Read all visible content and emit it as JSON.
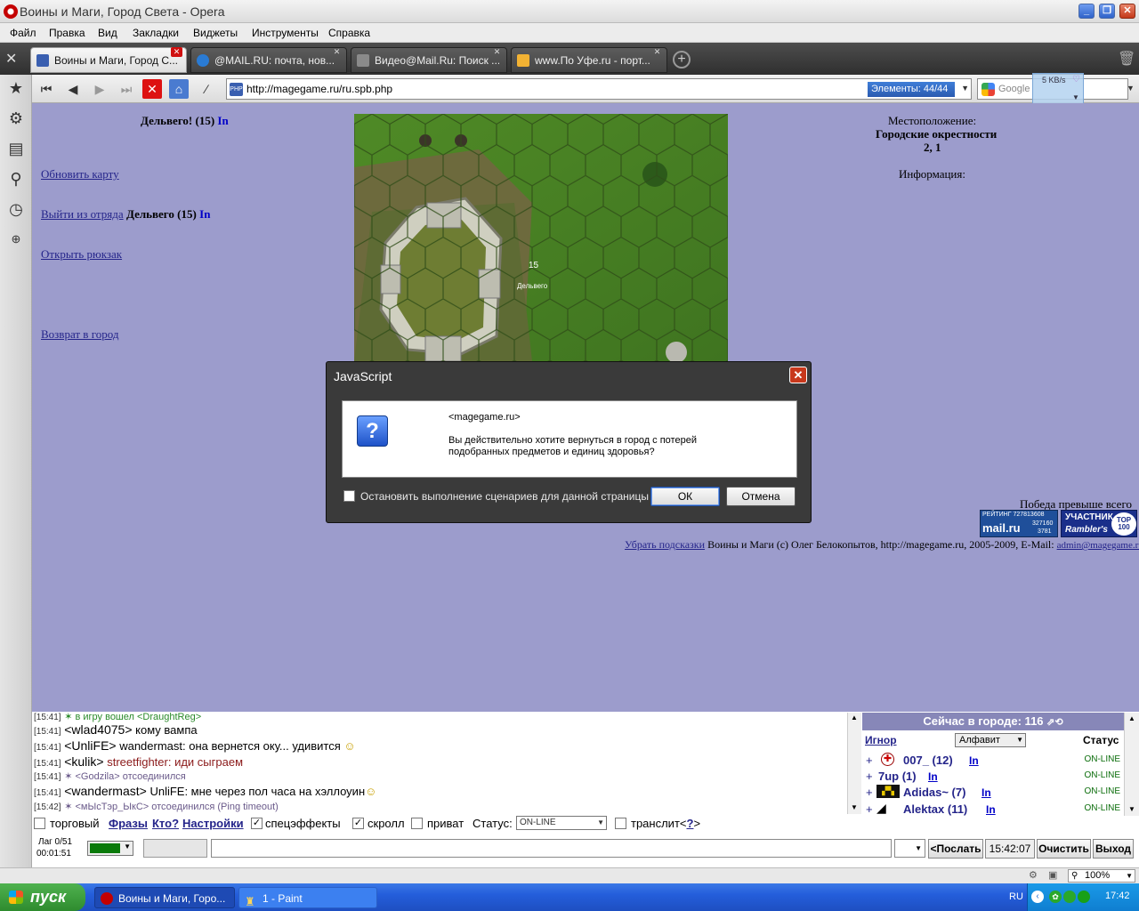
{
  "window": {
    "title": "Воины и Маги, Город Света - Opera"
  },
  "menu": [
    "Файл",
    "Правка",
    "Вид",
    "Закладки",
    "Виджеты",
    "Инструменты",
    "Справка"
  ],
  "tabs": [
    {
      "label": "Воины и Маги, Город С...",
      "active": true,
      "fav_color": "#3a5fb0"
    },
    {
      "label": "@MAIL.RU: почта, нов...",
      "active": false,
      "fav_color": "#2a7bd4"
    },
    {
      "label": "Видео@Mail.Ru: Поиск ...",
      "active": false,
      "fav_color": "#8a8a8a"
    },
    {
      "label": "www.По Уфе.ru - порт...",
      "active": false,
      "fav_color": "#f2b233"
    }
  ],
  "address": {
    "url": "http://magegame.ru/ru.spb.php",
    "progress": "Элементы:  44/44",
    "search_placeholder": "Google",
    "speed": "5 KB/s",
    "site_icon": "PHP"
  },
  "page": {
    "player_name": "Дельвего! (15)",
    "player_in": "In",
    "refresh_map": "Обновить карту",
    "leave_squad": "Выйти из отряда",
    "squad_member": "Дельвего (15)",
    "squad_in": "In",
    "open_backpack": "Открыть рюкзак",
    "return_city": "Возврат в город",
    "location_label": "Местоположение:",
    "location_name": "Городские окрестности",
    "location_coords": "2, 1",
    "info_label": "Информация:",
    "map_marker_level": "15",
    "map_marker_name": "Дельвего",
    "slogan": "Победа превыше всего",
    "hide_hints": "Убрать подсказки",
    "copyright": "Воины и Маги (c) Олег Белокопытов, http://magegame.ru, 2005-2009, E-Mail:",
    "email": "admin@magegame.ru",
    "counter_mail": "РЕЙТИНГ 727813608",
    "counter_mail_nums": [
      "327160",
      "3781"
    ],
    "counter_mail_brand": "mail.ru",
    "counter_rambler": "УЧАСТНИК",
    "counter_rambler_brand": "Rambler's",
    "counter_top": "TOP 100"
  },
  "dialog": {
    "title": "JavaScript",
    "host": "<magegame.ru>",
    "message": "Вы действительно хотите вернуться в город с потерей подобранных предметов и единиц здоровья?",
    "checkbox_label": "Остановить выполнение сценариев для данной страницы",
    "ok": "ОК",
    "cancel": "Отмена"
  },
  "chat": [
    {
      "time": "[15:41]",
      "kind": "sys",
      "text": "✶ в игру вошел <DraughtReg>"
    },
    {
      "time": "[15:41]",
      "kind": "msg",
      "nick": "<wlad4075>",
      "text": "кому вампа",
      "color": "#000000"
    },
    {
      "time": "[15:41]",
      "kind": "msg",
      "nick": "<UnliFE>",
      "text": "wandermast: она вернется оку... удивится",
      "color": "#000000"
    },
    {
      "time": "[15:41]",
      "kind": "msg",
      "nick": "<kulik>",
      "text": "streetfighter: иди сыграем",
      "color": "#8b1a1a"
    },
    {
      "time": "[15:41]",
      "kind": "sys",
      "text": "✶ <Godzila> отсоединился"
    },
    {
      "time": "[15:41]",
      "kind": "msg",
      "nick": "<wandermast>",
      "text": "UnliFE: мне через пол часа на хэллоуин",
      "color": "#000000"
    },
    {
      "time": "[15:42]",
      "kind": "sys",
      "text": "✶ <мЫсТэр_ЫкС> отсоединился (Ping timeout)"
    }
  ],
  "online": {
    "header": "Сейчас в городе: 116",
    "ignore": "Игнор",
    "sort": "Алфавит",
    "status_col": "Статус",
    "users": [
      {
        "plus": "+",
        "name": "007_ (12)",
        "in": "In",
        "status": "ON-LINE"
      },
      {
        "plus": "+",
        "name": "7up (1)",
        "in": "In",
        "status": "ON-LINE"
      },
      {
        "plus": "+",
        "name": "Adidas~ (7)",
        "in": "In",
        "status": "ON-LINE"
      },
      {
        "plus": "+",
        "name": "Alektax (11)",
        "in": "In",
        "status": "ON-LINE"
      }
    ]
  },
  "chat_controls": {
    "trade": "торговый",
    "phrases": "Фразы",
    "who": "Кто?",
    "settings": "Настройки",
    "effects": "спецэффекты",
    "scroll": "скролл",
    "private": "приват",
    "status_label": "Статус:",
    "status_value": "ON-LINE",
    "translit": "транслит<",
    "translit_q": "?",
    "translit_end": ">",
    "lag": "Лаг 0/51",
    "timer": "00:01:51",
    "send": "<Послать",
    "clock": "15:42:07",
    "clear": "Очистить",
    "exit": "Выход"
  },
  "statusbar": {
    "zoom": "100%"
  },
  "taskbar": {
    "start": "пуск",
    "tasks": [
      "Воины и Маги, Горо...",
      "1 - Paint"
    ],
    "lang": "RU",
    "time": "17:42"
  }
}
